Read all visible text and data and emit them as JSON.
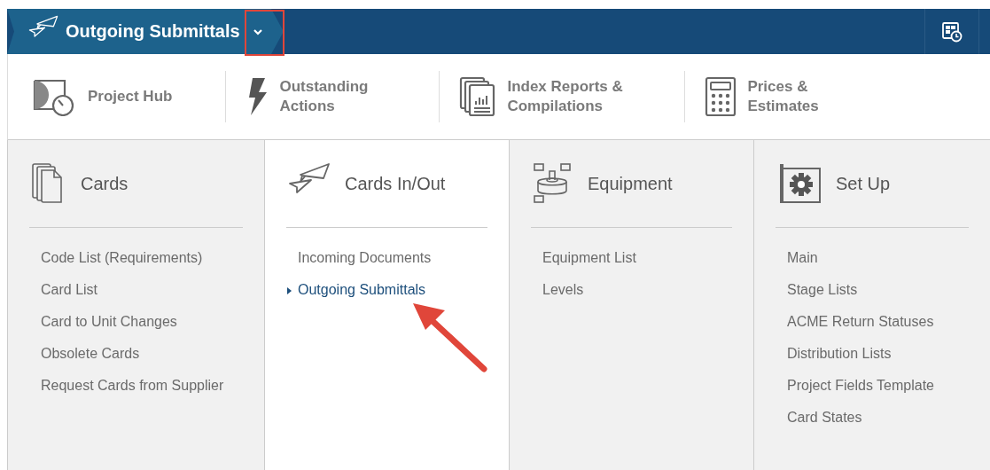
{
  "header": {
    "title": "Outgoing Submittals"
  },
  "toolbar": [
    {
      "kind": "hub",
      "label": "Project Hub"
    },
    {
      "kind": "bolt",
      "label": "Outstanding Actions"
    },
    {
      "kind": "report",
      "label": "Index Reports & Compilations"
    },
    {
      "kind": "calc",
      "label": "Prices & Estimates"
    }
  ],
  "columns": [
    {
      "kind": "cards",
      "title": "Cards",
      "selected": false,
      "links": [
        {
          "label": "Code List (Requirements)",
          "selected": false
        },
        {
          "label": "Card List",
          "selected": false
        },
        {
          "label": "Card to Unit Changes",
          "selected": false
        },
        {
          "label": "Obsolete Cards",
          "selected": false
        },
        {
          "label": "Request Cards from Supplier",
          "selected": false
        }
      ]
    },
    {
      "kind": "planes",
      "title": "Cards In/Out",
      "selected": true,
      "links": [
        {
          "label": "Incoming Documents",
          "selected": false
        },
        {
          "label": "Outgoing Submittals",
          "selected": true
        }
      ]
    },
    {
      "kind": "equipment",
      "title": "Equipment",
      "selected": false,
      "links": [
        {
          "label": "Equipment List",
          "selected": false
        },
        {
          "label": "Levels",
          "selected": false
        }
      ]
    },
    {
      "kind": "setup",
      "title": "Set Up",
      "selected": false,
      "links": [
        {
          "label": "Main",
          "selected": false
        },
        {
          "label": "Stage Lists",
          "selected": false
        },
        {
          "label": "ACME Return Statuses",
          "selected": false
        },
        {
          "label": "Distribution Lists",
          "selected": false
        },
        {
          "label": "Project Fields Template",
          "selected": false
        },
        {
          "label": "Card States",
          "selected": false
        }
      ]
    }
  ]
}
